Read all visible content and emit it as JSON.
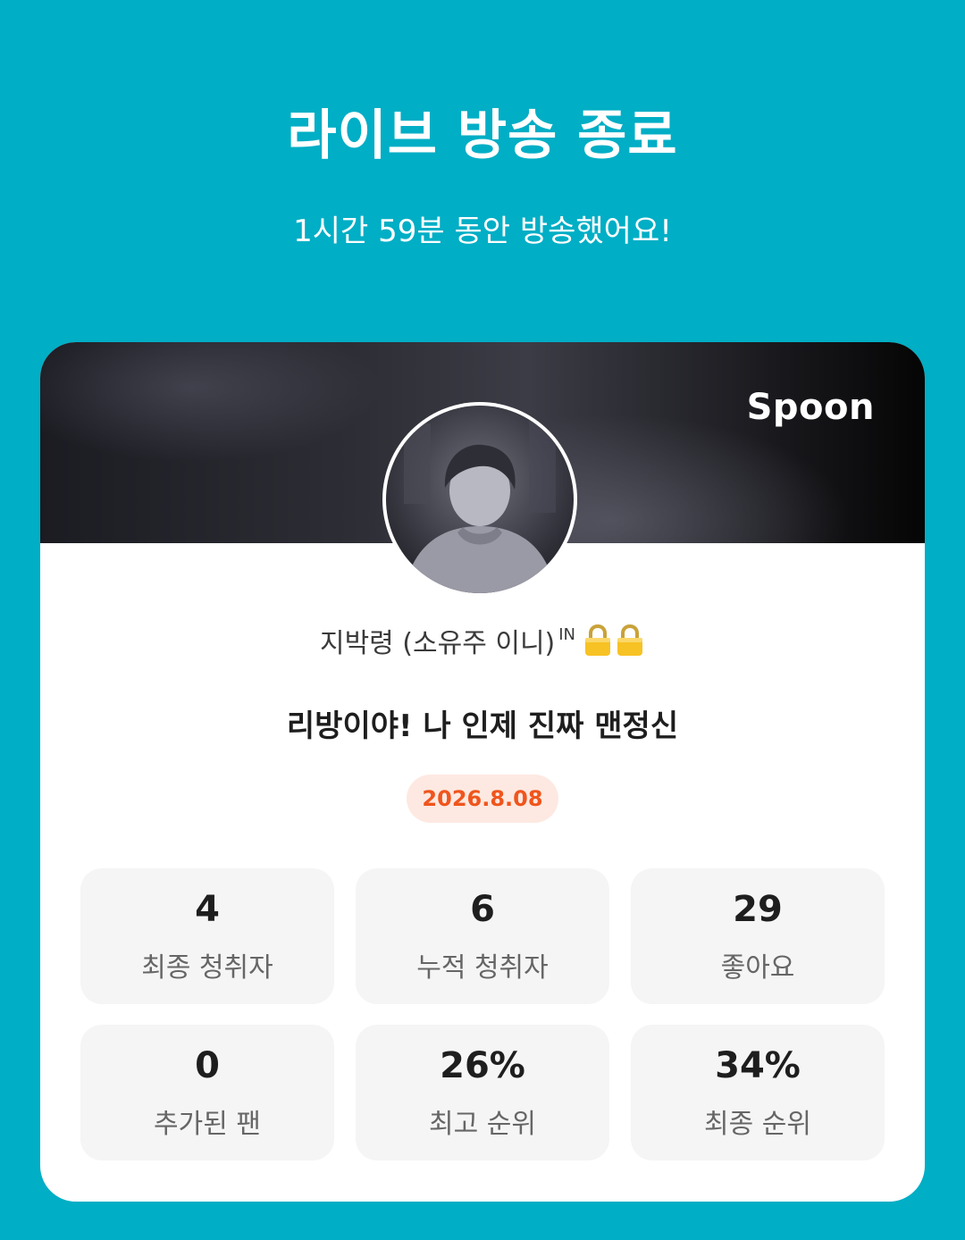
{
  "header": {
    "title": "라이브 방송 종료",
    "subtitle": "1시간 59분 동안 방송했어요!"
  },
  "card": {
    "brand": "Spoon",
    "nickname": "지박령 (소유주 이니)",
    "nickname_badge": "IN",
    "nickname_icons": [
      "lock-icon",
      "lock-icon"
    ],
    "broadcast_title": "리방이야! 나 인제 진짜 맨정신",
    "date": "2026.8.08",
    "stats": [
      {
        "value": "4",
        "label": "최종 청취자"
      },
      {
        "value": "6",
        "label": "누적 청취자"
      },
      {
        "value": "29",
        "label": "좋아요"
      },
      {
        "value": "0",
        "label": "추가된 팬"
      },
      {
        "value": "26%",
        "label": "최고 순위"
      },
      {
        "value": "34%",
        "label": "최종 순위"
      }
    ]
  },
  "colors": {
    "background": "#00aec5",
    "card": "#ffffff",
    "date_badge_bg": "#fde9e1",
    "date_badge_text": "#f0551d",
    "stat_tile_bg": "#f5f5f5"
  }
}
